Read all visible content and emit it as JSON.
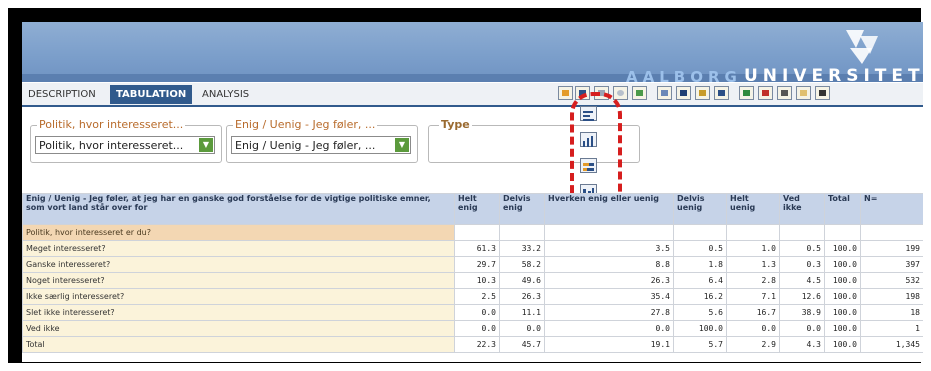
{
  "banner": {
    "brand_light": "AALBORG",
    "brand_bold": "UNIVERSITET"
  },
  "tabs": [
    {
      "label": "DESCRIPTION",
      "active": false
    },
    {
      "label": "TABULATION",
      "active": true
    },
    {
      "label": "ANALYSIS",
      "active": false
    }
  ],
  "filters": {
    "row": {
      "legend": "Politik, hvor interesseret...",
      "value": "Politik, hvor interesseret..."
    },
    "col": {
      "legend": "Enig / Uenig - Jeg føler, ...",
      "value": "Enig / Uenig - Jeg føler, ..."
    },
    "type": {
      "legend": "Type"
    }
  },
  "chart_type_icons": [
    "horizontal-bar-icon",
    "vertical-bar-icon",
    "stacked-horizontal-bar-icon",
    "stacked-vertical-bar-icon",
    "pie-chart-icon"
  ],
  "table": {
    "question": "Enig / Uenig - Jeg føler, at jeg har en ganske god forståelse for de vigtige politiske emner, som vort land står over for",
    "headers": [
      "Helt enig",
      "Delvis enig",
      "Hverken enig eller uenig",
      "Delvis uenig",
      "Helt uenig",
      "Ved ikke",
      "Total",
      "N="
    ],
    "group_label": "Politik, hvor interesseret er du?",
    "rows": [
      {
        "label": "Meget interesseret?",
        "values": [
          "61.3",
          "33.2",
          "3.5",
          "0.5",
          "1.0",
          "0.5",
          "100.0",
          "199"
        ]
      },
      {
        "label": "Ganske interesseret?",
        "values": [
          "29.7",
          "58.2",
          "8.8",
          "1.8",
          "1.3",
          "0.3",
          "100.0",
          "397"
        ]
      },
      {
        "label": "Noget interesseret?",
        "values": [
          "10.3",
          "49.6",
          "26.3",
          "6.4",
          "2.8",
          "4.5",
          "100.0",
          "532"
        ]
      },
      {
        "label": "Ikke særlig interesseret?",
        "values": [
          "2.5",
          "26.3",
          "35.4",
          "16.2",
          "7.1",
          "12.6",
          "100.0",
          "198"
        ]
      },
      {
        "label": "Slet ikke interesseret?",
        "values": [
          "0.0",
          "11.1",
          "27.8",
          "5.6",
          "16.7",
          "38.9",
          "100.0",
          "18"
        ]
      },
      {
        "label": "Ved ikke",
        "values": [
          "0.0",
          "0.0",
          "0.0",
          "100.0",
          "0.0",
          "0.0",
          "100.0",
          "1"
        ]
      },
      {
        "label": "Total",
        "values": [
          "22.3",
          "45.7",
          "19.1",
          "5.7",
          "2.9",
          "4.3",
          "100.0",
          "1,345"
        ]
      }
    ]
  },
  "colors": {
    "accent": "#315a8c",
    "highlight": "#d61e1e",
    "banner": "#7c9fcb"
  }
}
